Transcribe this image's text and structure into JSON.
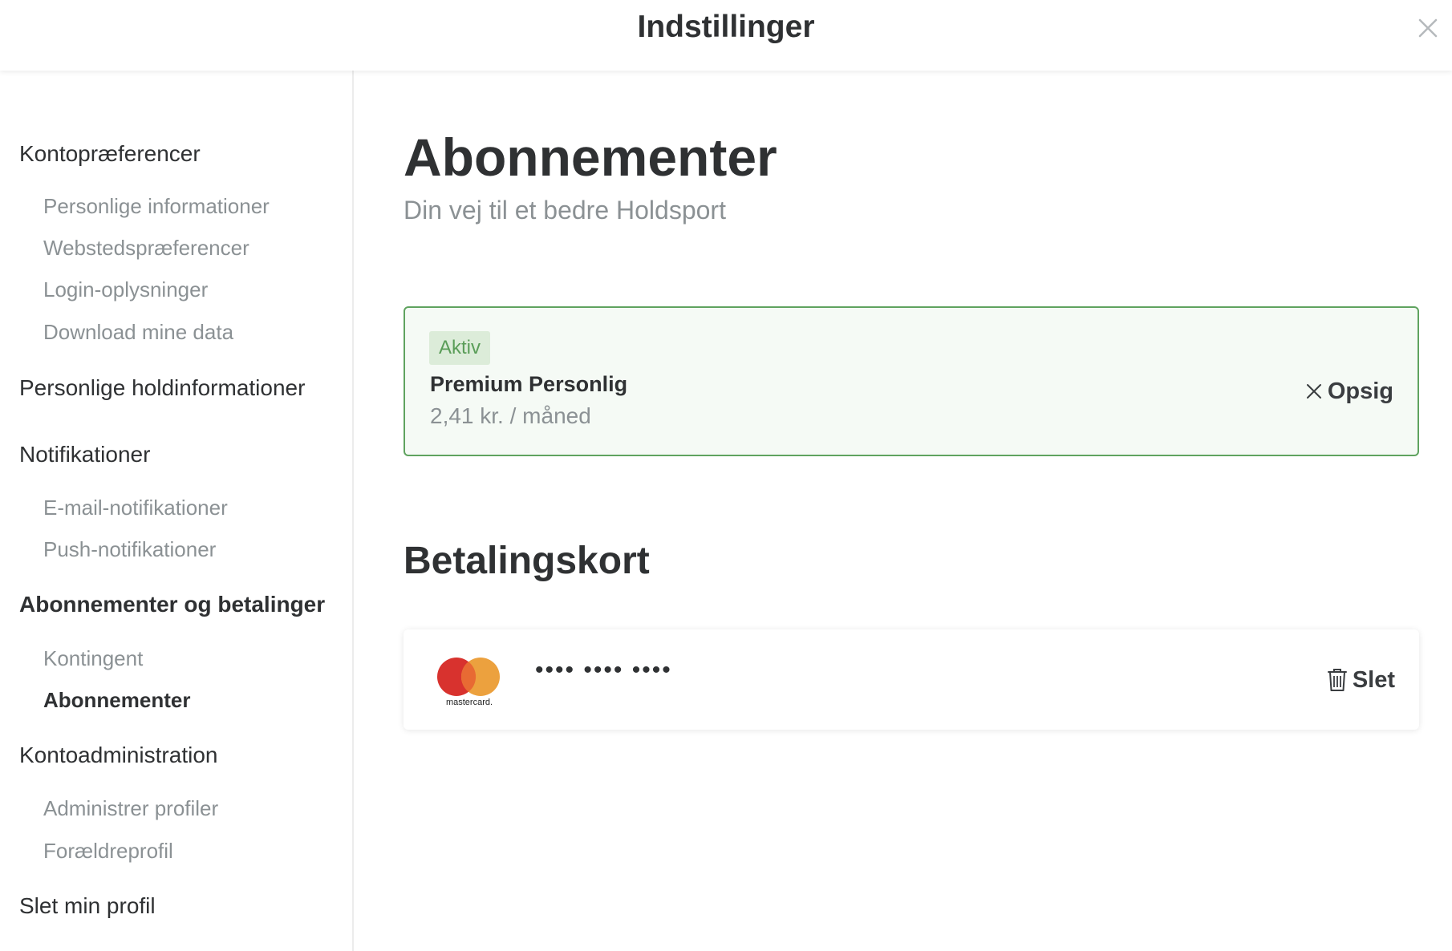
{
  "header": {
    "title": "Indstillinger"
  },
  "sidebar": {
    "sections": [
      {
        "label": "Kontopræferencer",
        "items": [
          "Personlige informationer",
          "Webstedspræferencer",
          "Login-oplysninger",
          "Download mine data"
        ]
      },
      {
        "label": "Personlige holdinformationer",
        "items": []
      },
      {
        "label": "Notifikationer",
        "items": [
          "E-mail-notifikationer",
          "Push-notifikationer"
        ]
      },
      {
        "label": "Abonnementer og betalinger",
        "items": [
          "Kontingent",
          "Abonnementer"
        ]
      },
      {
        "label": "Kontoadministration",
        "items": [
          "Administrer profiler",
          "Forældreprofil"
        ]
      },
      {
        "label": "Slet min profil",
        "items": []
      }
    ],
    "active_section": "Abonnementer og betalinger",
    "active_item": "Abonnementer"
  },
  "main": {
    "title": "Abonnementer",
    "subtitle": "Din vej til et bedre Holdsport",
    "subscription": {
      "status": "Aktiv",
      "plan": "Premium Personlig",
      "price": "2,41 kr. / måned",
      "cancel_label": "Opsig"
    },
    "payment_section_title": "Betalingskort",
    "card": {
      "brand": "mastercard",
      "number_masked": "•••• •••• ••••",
      "delete_label": "Slet"
    }
  },
  "icons": {
    "close": "close-icon",
    "cancel": "x-icon",
    "delete": "trash-icon",
    "card_brand": "mastercard-logo"
  },
  "colors": {
    "active_border": "#5fa35f",
    "badge_bg": "#dcecd9",
    "badge_text": "#5a9d58",
    "muted": "#8b9194",
    "text": "#2f3133"
  }
}
